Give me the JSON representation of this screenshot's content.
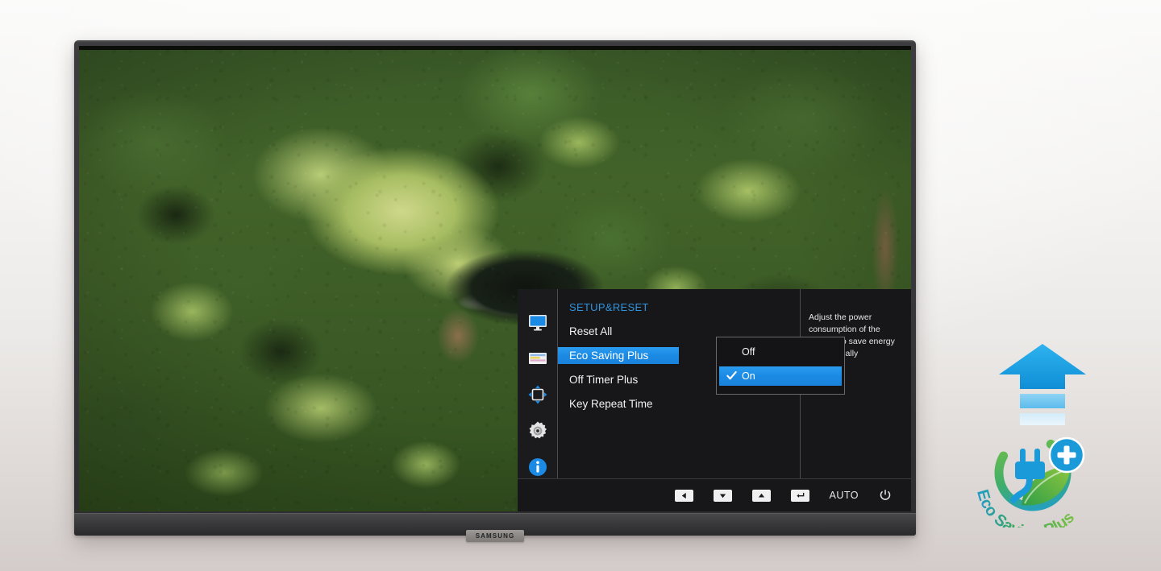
{
  "product": {
    "brand": "SAMSUNG",
    "brand_badge_label": "SAMSUNG"
  },
  "osd": {
    "title": "SETUP&RESET",
    "title_color": "#2f93dd",
    "highlight_color": "#1b8ae4",
    "background_color": "#17171a",
    "text_color": "#f2f2f2",
    "icon_rail": [
      {
        "name": "display-icon",
        "label": "Picture"
      },
      {
        "name": "onscreen-display-icon",
        "label": "OnScreen Display"
      },
      {
        "name": "pip-pbp-icon",
        "label": "PIP/PBP"
      },
      {
        "name": "setup-reset-gear-icon",
        "label": "Setup&Reset"
      },
      {
        "name": "information-icon",
        "label": "Information"
      }
    ],
    "menu_items": [
      {
        "label": "Reset All",
        "selected": false
      },
      {
        "label": "Eco Saving Plus",
        "selected": true
      },
      {
        "label": "Off Timer Plus",
        "selected": false
      },
      {
        "label": "Key Repeat Time",
        "selected": false
      }
    ],
    "submenu": {
      "parent": "Eco Saving Plus",
      "options": [
        {
          "label": "Off",
          "selected": false,
          "checked": false
        },
        {
          "label": "On",
          "selected": true,
          "checked": true
        }
      ]
    },
    "description": "Adjust the power consumption of the product to save energy automatically",
    "footer_keys": [
      {
        "name": "left-arrow-key",
        "glyph": "left"
      },
      {
        "name": "down-arrow-key",
        "glyph": "down"
      },
      {
        "name": "up-arrow-key",
        "glyph": "up"
      },
      {
        "name": "enter-key",
        "glyph": "enter"
      },
      {
        "name": "auto-key",
        "glyph": "text",
        "label": "AUTO"
      },
      {
        "name": "power-key",
        "glyph": "power"
      }
    ]
  },
  "eco_badge": {
    "name": "eco-saving-plus-logo",
    "text": "Eco Saving Plus",
    "arrow_name": "upward-energy-arrow-icon",
    "colors": {
      "arrow_blue": "#1e9fe0",
      "plug_blue": "#1b9ad9",
      "leaf_green": "#5cb335",
      "ring_green": "#5cb335",
      "ring_blue": "#1b9ad9",
      "plus_blue": "#1b9ad9"
    }
  },
  "wallpaper": {
    "name": "aerial-rainforest-canopy-photo",
    "description": "Aerial view of dense green rainforest canopy with a dark pond and dirt path"
  }
}
